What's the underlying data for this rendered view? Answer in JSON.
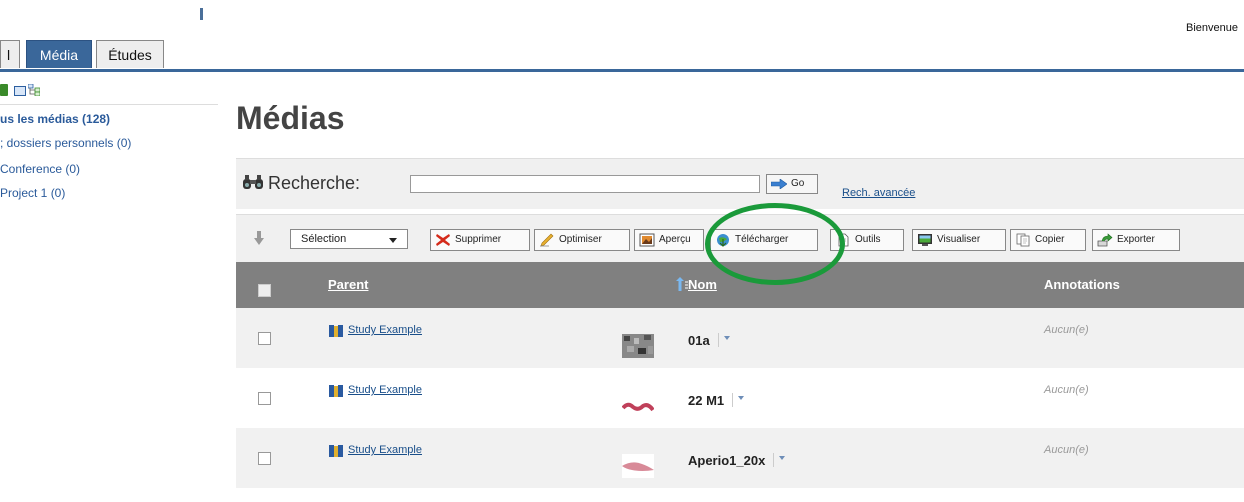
{
  "header": {
    "welcome": "Bienvenue",
    "tabs": [
      {
        "label": "l"
      },
      {
        "label": "Média",
        "active": true
      },
      {
        "label": "Études"
      }
    ]
  },
  "sidebar": {
    "items": [
      {
        "label": "us les médias (128)",
        "bold": true
      },
      {
        "label": "; dossiers personnels (0)"
      },
      {
        "label": "Conference (0)"
      },
      {
        "label": "Project 1 (0)"
      }
    ]
  },
  "main": {
    "title": "Médias",
    "search": {
      "label": "Recherche:",
      "value": "",
      "go_label": "Go",
      "advanced_link": "Rech. avancée"
    },
    "toolbar": {
      "select_value": "Sélection",
      "buttons": [
        {
          "label": "Supprimer",
          "icon": "delete-x-icon"
        },
        {
          "label": "Optimiser",
          "icon": "pencil-icon"
        },
        {
          "label": "Aperçu",
          "icon": "image-icon"
        },
        {
          "label": "Télécharger",
          "icon": "download-globe-icon"
        },
        {
          "label": "Outils",
          "icon": "document-icon"
        },
        {
          "label": "Visualiser",
          "icon": "monitor-icon"
        },
        {
          "label": "Copier",
          "icon": "copy-icon"
        },
        {
          "label": "Exporter",
          "icon": "export-icon"
        }
      ]
    },
    "table": {
      "headers": {
        "parent": "Parent",
        "name": "Nom",
        "annotations": "Annotations"
      },
      "rows": [
        {
          "parent": "Study Example",
          "name": "01a",
          "annotations": "Aucun(e)"
        },
        {
          "parent": "Study Example",
          "name": "22 M1",
          "annotations": "Aucun(e)"
        },
        {
          "parent": "Study Example",
          "name": "Aperio1_20x",
          "annotations": "Aucun(e)"
        }
      ]
    }
  },
  "colors": {
    "brand_blue": "#3a679a",
    "header_gray": "#808080",
    "highlight_green": "#1a9a3a",
    "link_blue": "#1a4f8a"
  }
}
